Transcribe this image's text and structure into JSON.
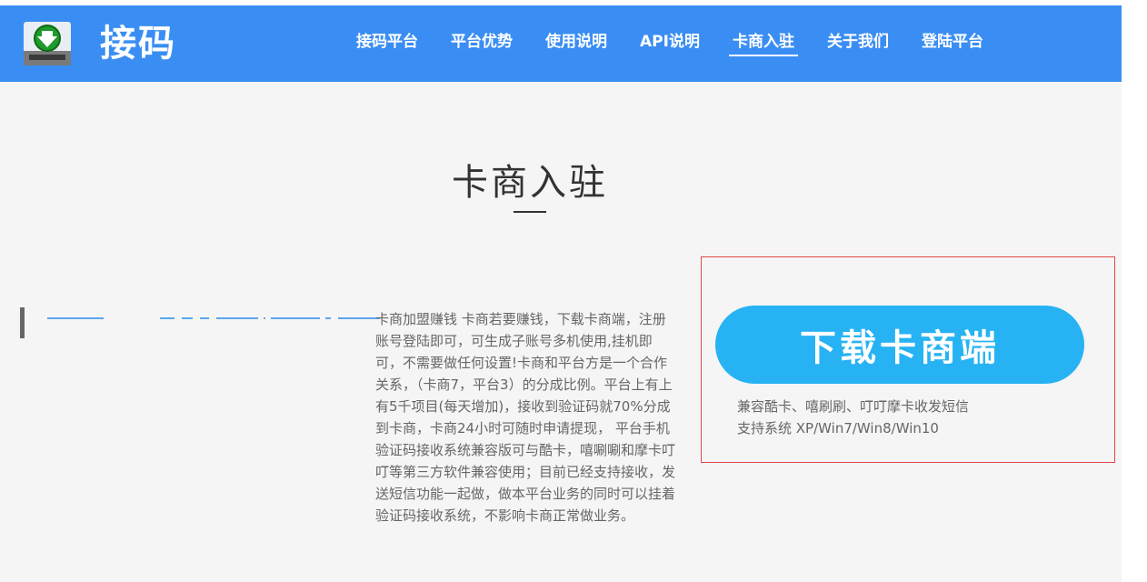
{
  "header": {
    "brand": "接码",
    "nav": [
      {
        "label": "接码平台"
      },
      {
        "label": "平台优势"
      },
      {
        "label": "使用说明"
      },
      {
        "label": "API说明"
      },
      {
        "label": "卡商入驻"
      },
      {
        "label": "关于我们"
      },
      {
        "label": "登陆平台"
      }
    ],
    "active_nav": "卡商入驻",
    "accent_color": "#3a8ef3"
  },
  "main": {
    "title": "卡商入驻",
    "description": "卡商加盟赚钱 卡商若要赚钱，下载卡商端，注册账号登陆即可，可生成子账号多机使用,挂机即可，不需要做任何设置!卡商和平台方是一个合作关系，（卡商7，平台3）的分成比例。平台上有上有5千项目(每天增加)，接收到验证码就70%分成到卡商，卡商24小时可随时申请提现， 平台手机验证码接收系统兼容版可与酷卡，嘻唰唰和摩卡叮叮等第三方软件兼容使用；目前已经支持接收，发送短信功能一起做，做本平台业务的同时可以挂着验证码接收系统，不影响卡商正常做业务。"
  },
  "download": {
    "button_label": "下载卡商端",
    "compat_note": "兼容酷卡、嘻刷刷、叮叮摩卡收发短信",
    "system_note": "支持系统 XP/Win7/Win8/Win10",
    "button_color": "#27b3f3",
    "highlight_border_color": "#e04848"
  },
  "icons": {
    "logo": "download-tray-icon"
  }
}
